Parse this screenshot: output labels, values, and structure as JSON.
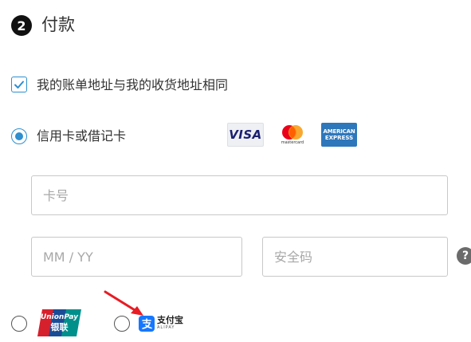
{
  "section": {
    "step_number": "2",
    "title": "付款"
  },
  "billing_same": {
    "label": "我的账单地址与我的收货地址相同",
    "checked": true
  },
  "payment_methods": {
    "card": {
      "label": "信用卡或借记卡",
      "selected": true
    },
    "card_brands": {
      "visa": "VISA",
      "mastercard": "mastercard",
      "amex_top": "AMERICAN",
      "amex_bottom": "EXPRESS"
    },
    "unionpay": {
      "logo_text_top": "UnionPay",
      "logo_text_bottom": "银联",
      "selected": false
    },
    "alipay": {
      "logo_text": "支付宝",
      "logo_subtext": "ALIPAY",
      "selected": false
    }
  },
  "form": {
    "card_number": {
      "placeholder": "卡号",
      "value": ""
    },
    "expiry": {
      "placeholder": "MM / YY",
      "value": ""
    },
    "cvv": {
      "placeholder": "安全码",
      "value": ""
    },
    "help": "?"
  },
  "colors": {
    "accent": "#2f8fcf",
    "visa_blue": "#1a1f71",
    "mastercard_red": "#eb001b",
    "mastercard_orange": "#f79e1b",
    "amex_blue": "#2e77bb",
    "unionpay_red": "#d6202c",
    "unionpay_blue": "#1a4c96",
    "unionpay_green": "#00908c",
    "alipay_blue": "#1677ff",
    "annotation_red": "#e81c24"
  },
  "icons": [
    "check-icon",
    "visa-logo-icon",
    "mastercard-logo-icon",
    "amex-logo-icon",
    "unionpay-logo-icon",
    "alipay-logo-icon",
    "help-icon",
    "annotation-arrow-icon"
  ]
}
